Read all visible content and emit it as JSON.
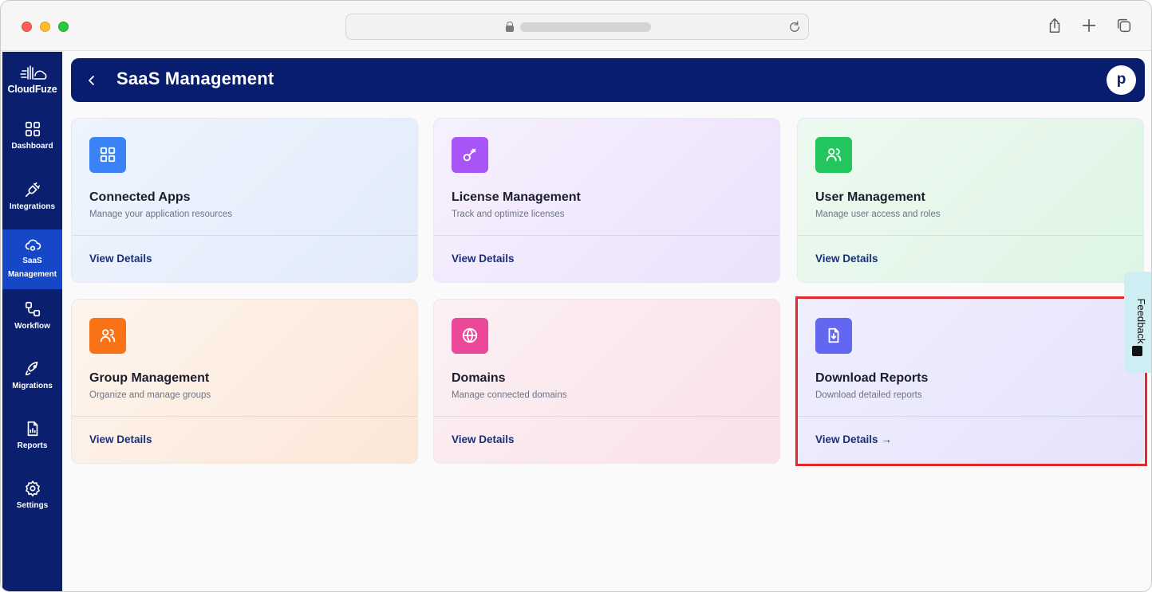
{
  "browser": {
    "icons": [
      "lock-icon",
      "reload-icon",
      "share-icon",
      "new-tab-icon",
      "tabs-overview-icon"
    ]
  },
  "sidebar": {
    "logo_text": "CloudFuze",
    "items": [
      {
        "label": "Dashboard",
        "icon": "dashboard-icon",
        "active": false
      },
      {
        "label": "Integrations",
        "icon": "plug-icon",
        "active": false
      },
      {
        "label": "SaaS Management",
        "icon": "cloud-gear-icon",
        "active": true
      },
      {
        "label": "Workflow",
        "icon": "workflow-icon",
        "active": false
      },
      {
        "label": "Migrations",
        "icon": "rocket-icon",
        "active": false
      },
      {
        "label": "Reports",
        "icon": "report-icon",
        "active": false
      },
      {
        "label": "Settings",
        "icon": "gear-icon",
        "active": false
      }
    ]
  },
  "header": {
    "title": "SaaS Management",
    "avatar_initial": "p"
  },
  "cards": [
    {
      "title": "Connected Apps",
      "desc": "Manage your application resources",
      "link": "View Details",
      "icon": "grid-icon",
      "icon_color": "#3b82f6"
    },
    {
      "title": "License Management",
      "desc": "Track and optimize licenses",
      "link": "View Details",
      "icon": "key-icon",
      "icon_color": "#a855f7"
    },
    {
      "title": "User Management",
      "desc": "Manage user access and roles",
      "link": "View Details",
      "icon": "users-icon",
      "icon_color": "#22c55e"
    },
    {
      "title": "Group Management",
      "desc": "Organize and manage groups",
      "link": "View Details",
      "icon": "group-icon",
      "icon_color": "#f97316"
    },
    {
      "title": "Domains",
      "desc": "Manage connected domains",
      "link": "View Details",
      "icon": "globe-icon",
      "icon_color": "#ec4899"
    },
    {
      "title": "Download Reports",
      "desc": "Download detailed reports",
      "link": "View Details →",
      "icon": "file-download-icon",
      "icon_color": "#6366f1"
    }
  ],
  "feedback": {
    "label": "Feedback"
  },
  "colors": {
    "sidebar": "#0a1f6d",
    "active": "#1547c7",
    "highlight": "#e0282e"
  }
}
